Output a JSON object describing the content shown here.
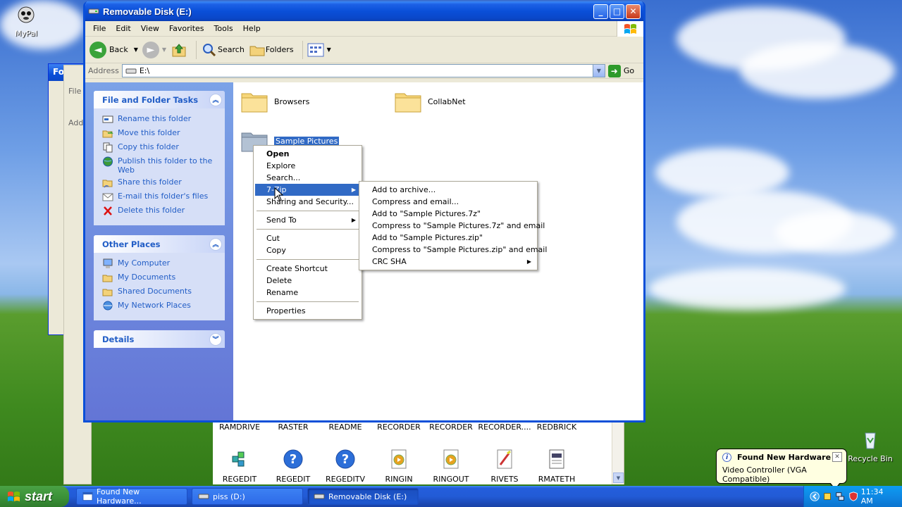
{
  "desktop": {
    "icons": [
      {
        "label": "MyPal"
      },
      {
        "label": "Recycle Bin"
      }
    ]
  },
  "background_windows": {
    "left_title_fragment": "Fo",
    "menu_fragment": "File",
    "address_fragment": "Add"
  },
  "window": {
    "title": "Removable Disk (E:)",
    "controls": {
      "minimize": "_",
      "maximize": "□",
      "close": "✕"
    },
    "menu": [
      "File",
      "Edit",
      "View",
      "Favorites",
      "Tools",
      "Help"
    ],
    "toolbar": {
      "back": "Back",
      "search": "Search",
      "folders": "Folders"
    },
    "address": {
      "label": "Address",
      "value": "E:\\",
      "go": "Go"
    },
    "tasks": {
      "file_folder": {
        "title": "File and Folder Tasks",
        "items": [
          "Rename this folder",
          "Move this folder",
          "Copy this folder",
          "Publish this folder to the Web",
          "Share this folder",
          "E-mail this folder's files",
          "Delete this folder"
        ]
      },
      "other_places": {
        "title": "Other Places",
        "items": [
          "My Computer",
          "My Documents",
          "Shared Documents",
          "My Network Places"
        ]
      },
      "details": {
        "title": "Details"
      }
    },
    "folders": [
      {
        "name": "Browsers"
      },
      {
        "name": "CollabNet"
      },
      {
        "name": "Sample Pictures"
      }
    ]
  },
  "context_menu": {
    "items": {
      "open": "Open",
      "explore": "Explore",
      "search": "Search...",
      "sevenzip": "7-Zip",
      "sharing": "Sharing and Security...",
      "sendto": "Send To",
      "cut": "Cut",
      "copy": "Copy",
      "shortcut": "Create Shortcut",
      "delete": "Delete",
      "rename": "Rename",
      "properties": "Properties"
    }
  },
  "submenu": {
    "items": [
      "Add to archive...",
      "Compress and email...",
      "Add to \"Sample Pictures.7z\"",
      "Compress to \"Sample Pictures.7z\" and email",
      "Add to \"Sample Pictures.zip\"",
      "Compress to \"Sample Pictures.zip\" and email",
      "CRC SHA"
    ]
  },
  "back_window": {
    "top_labels": [
      "RAMDRIVE",
      "RASTER",
      "README",
      "RECORDER",
      "RECORDER",
      "RECORDER....",
      "REDBRICK"
    ],
    "icons": [
      "REGEDIT",
      "REGEDIT",
      "REGEDITV",
      "RINGIN",
      "RINGOUT",
      "RIVETS",
      "RMATETH"
    ]
  },
  "balloon": {
    "title": "Found New Hardware",
    "text": "Video Controller (VGA Compatible)"
  },
  "taskbar": {
    "start": "start",
    "tasks": [
      "Found New Hardware...",
      "piss (D:)",
      "Removable Disk (E:)"
    ],
    "clock": "11:34 AM"
  }
}
